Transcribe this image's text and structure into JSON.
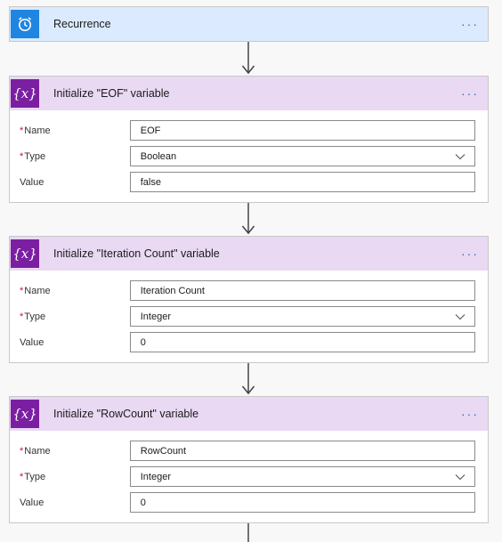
{
  "trigger": {
    "title": "Recurrence",
    "icon": "alarm-clock-icon",
    "color": "#1f85e0",
    "more": "···"
  },
  "actions": [
    {
      "title": "Initialize \"EOF\" variable",
      "icon": "variable-icon",
      "icon_text": "{x}",
      "more": "···",
      "fields": {
        "name_label": "Name",
        "name_value": "EOF",
        "type_label": "Type",
        "type_value": "Boolean",
        "value_label": "Value",
        "value_value": "false"
      }
    },
    {
      "title": "Initialize \"Iteration Count\" variable",
      "icon": "variable-icon",
      "icon_text": "{x}",
      "more": "···",
      "fields": {
        "name_label": "Name",
        "name_value": "Iteration Count",
        "type_label": "Type",
        "type_value": "Integer",
        "value_label": "Value",
        "value_value": "0"
      }
    },
    {
      "title": "Initialize \"RowCount\" variable",
      "icon": "variable-icon",
      "icon_text": "{x}",
      "more": "···",
      "fields": {
        "name_label": "Name",
        "name_value": "RowCount",
        "type_label": "Type",
        "type_value": "Integer",
        "value_label": "Value",
        "value_value": "0"
      }
    }
  ],
  "required_marker": "*",
  "colors": {
    "variable_purple": "#7b1fa2",
    "variable_header": "#e9d9f3",
    "trigger_header": "#dbeafe",
    "required": "#c8102e",
    "more": "#1f6fc4"
  }
}
